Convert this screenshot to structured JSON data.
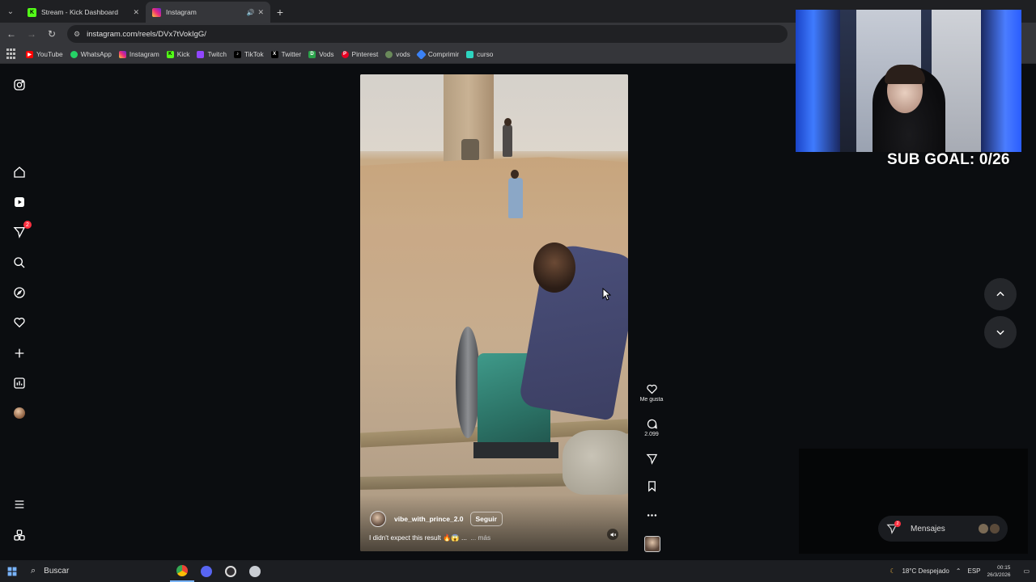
{
  "browser": {
    "tabs": [
      {
        "title": "Stream - Kick Dashboard",
        "favicon": "kick-icon",
        "active": false
      },
      {
        "title": "Instagram",
        "favicon": "instagram-icon",
        "active": true
      }
    ],
    "new_tab": "+",
    "address": "instagram.com/reels/DVx7tVokIgG/",
    "bookmarks": [
      {
        "label": "YouTube",
        "color": "#ff0000"
      },
      {
        "label": "WhatsApp",
        "color": "#25d366"
      },
      {
        "label": "Instagram",
        "color": "#e1306c"
      },
      {
        "label": "Kick",
        "color": "#53fc18"
      },
      {
        "label": "Twitch",
        "color": "#9146ff"
      },
      {
        "label": "TikTok",
        "color": "#000000"
      },
      {
        "label": "Twitter",
        "color": "#000000"
      },
      {
        "label": "Vods",
        "color": "#2aa34a"
      },
      {
        "label": "Pinterest",
        "color": "#e60023"
      },
      {
        "label": "vods",
        "color": "#6a8a5a"
      },
      {
        "label": "Comprimir",
        "color": "#3b82f6"
      },
      {
        "label": "curso",
        "color": "#2dd4bf"
      }
    ]
  },
  "sidebar": {
    "notifications_badge": "2",
    "items": [
      "instagram-logo-icon",
      "home-icon",
      "reels-icon",
      "messages-icon",
      "search-icon",
      "explore-icon",
      "notifications-icon",
      "create-icon",
      "dashboard-icon",
      "profile-avatar",
      "menu-icon",
      "meta-icon"
    ]
  },
  "reel": {
    "author": "vibe_with_prince_2.0",
    "follow_label": "Seguir",
    "caption": "I didn't expect this result 🔥😱 ...",
    "more_label": "... más"
  },
  "actions": {
    "like_label": "Me gusta",
    "comments_count": "2.099"
  },
  "overlay": {
    "sub_goal": "SUB GOAL: 0/26"
  },
  "messages": {
    "label": "Mensajes",
    "badge": "2"
  },
  "taskbar": {
    "search_label": "Buscar",
    "weather": "18°C  Despejado",
    "language": "ESP",
    "time": "00:15",
    "date": "26/3/2026"
  },
  "colors": {
    "background": "#0b0d10",
    "accent_red": "#ff3040",
    "tab_active": "#35363a"
  }
}
